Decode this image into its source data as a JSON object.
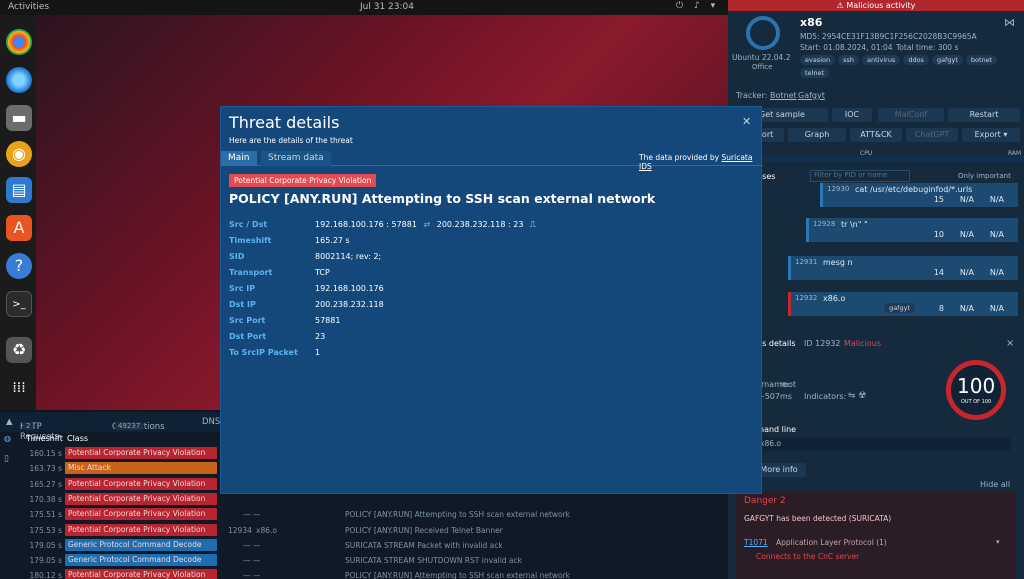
{
  "topbar": {
    "activities": "Activities",
    "clock": "Jul 31  23:04",
    "tray": "⏻ ♪ ▾"
  },
  "dock": {
    "icons": [
      "chrome-icon",
      "thunderbird-icon",
      "files-icon",
      "rhythmbox-icon",
      "writer-icon",
      "software-icon",
      "help-icon",
      "terminal-icon",
      "trash-icon",
      "apps-grid-icon"
    ]
  },
  "bottom": {
    "tabs": {
      "http": "HTTP Requests",
      "http_count": "2",
      "connections": "Connections",
      "connections_count": "49237",
      "dns": "DNS"
    },
    "headers": {
      "timeshift": "Timeshift",
      "class": "Class"
    },
    "rows": [
      {
        "ts": "160.15 s",
        "cls": "Potential Corporate Privacy Violation",
        "color": "red",
        "pid": "",
        "proc": "",
        "m": "",
        "msg": ""
      },
      {
        "ts": "163.73 s",
        "cls": "Misc Attack",
        "color": "org",
        "pid": "",
        "proc": "",
        "m": "",
        "msg": ""
      },
      {
        "ts": "165.27 s",
        "cls": "Potential Corporate Privacy Violation",
        "color": "red",
        "pid": "",
        "proc": "",
        "m": "",
        "msg": ""
      },
      {
        "ts": "170.38 s",
        "cls": "Potential Corporate Privacy Violation",
        "color": "red",
        "pid": "",
        "proc": "",
        "m": "",
        "msg": ""
      },
      {
        "ts": "175.51 s",
        "cls": "Potential Corporate Privacy Violation",
        "color": "red",
        "pid": "",
        "proc": "",
        "m": "— —",
        "msg": "POLICY [ANY.RUN] Attempting to SSH scan external network"
      },
      {
        "ts": "175.53 s",
        "cls": "Potential Corporate Privacy Violation",
        "color": "red",
        "pid": "12934",
        "proc": "x86.o",
        "m": "",
        "msg": "POLICY [ANY.RUN] Received Telnet Banner"
      },
      {
        "ts": "179.05 s",
        "cls": "Generic Protocol Command Decode",
        "color": "blu",
        "pid": "",
        "proc": "",
        "m": "— —",
        "msg": "SURICATA STREAM Packet with invalid ack"
      },
      {
        "ts": "179.05 s",
        "cls": "Generic Protocol Command Decode",
        "color": "blu",
        "pid": "",
        "proc": "",
        "m": "— —",
        "msg": "SURICATA STREAM SHUTDOWN RST invalid ack"
      },
      {
        "ts": "180.12 s",
        "cls": "Potential Corporate Privacy Violation",
        "color": "red",
        "pid": "",
        "proc": "",
        "m": "— —",
        "msg": "POLICY [ANY.RUN] Attempting to SSH scan external network"
      }
    ]
  },
  "right": {
    "banner": "Malicious activity",
    "os_name": "Ubuntu 22.04.2",
    "os_sub": "Office",
    "file": "x86",
    "md5": "MD5: 2954CE31F13B9C1F256C2028B3C9965A",
    "start": "Start: 01.08.2024, 01:04",
    "total": "Total time: 300 s",
    "tags": [
      "evasion",
      "ssh",
      "antivirus",
      "ddos",
      "gafgyt",
      "botnet",
      "telnet"
    ],
    "tracker_label": "Tracker:",
    "trackers": [
      "Botnet",
      "Gafgyt"
    ],
    "buttons": {
      "sample": "Get sample",
      "ioc": "IOC",
      "malconf": "MalConf",
      "restart": "Restart",
      "report": "Report",
      "graph": "Graph",
      "attack": "ATT&CK",
      "chatgpt": "ChatGPT",
      "export": "Export"
    },
    "cpu": "CPU",
    "ram": "RAM",
    "processes_label": "Processes",
    "filter_placeholder": "Filter by PID or name",
    "only_important": "Only important",
    "procs": [
      {
        "pid": "12930",
        "name": "cat  /usr/etc/debuginfod/*.urls",
        "val": "15",
        "na1": "N/A",
        "na2": "N/A"
      },
      {
        "pid": "12928",
        "name": "tr  \\n\" \"",
        "val": "10",
        "na1": "N/A",
        "na2": "N/A"
      },
      {
        "pid": "12931",
        "name": "mesg  n",
        "val": "14",
        "na1": "N/A",
        "na2": "N/A"
      },
      {
        "pid": "12932",
        "name": "x86.o",
        "val": "8",
        "na1": "N/A",
        "na2": "N/A",
        "tag": "gafgyt"
      }
    ],
    "details_label": "Process details",
    "details_id": "ID 12932",
    "details_verdict": "Malicious",
    "user_label": "Username:",
    "user": "root",
    "time": "+507ms",
    "indicators_label": "Indicators:",
    "score": "100",
    "score_sub": "OUT OF 100",
    "cmd_label": "Command line",
    "cmd": "/tmp/x86.o",
    "more_info": "More info",
    "hide_all": "Hide all",
    "danger_label": "Danger",
    "danger_count": "2",
    "danger1": "GAFGYT has been detected (SURICATA)",
    "t1071": "T1071",
    "t1071_desc": "Application Layer Protocol (1)",
    "cnc": "Connects to the CnC server"
  },
  "modal": {
    "title": "Threat details",
    "subtitle": "Here are the details of the threat",
    "tabs": [
      "Main",
      "Stream data"
    ],
    "provider_prefix": "The data provided by",
    "provider": "Suricata IDS",
    "category": "Potential Corporate Privacy Violation",
    "headline": "POLICY [ANY.RUN] Attempting to SSH scan external network",
    "src_dst_label": "Src / Dst",
    "src_dst_a": "192.168.100.176 : 57881",
    "src_dst_b": "200.238.232.118 : 23",
    "fields": [
      {
        "k": "Timeshift",
        "v": "165.27 s"
      },
      {
        "k": "SID",
        "v": "8002114; rev: 2;"
      },
      {
        "k": "Transport",
        "v": "TCP"
      },
      {
        "k": "Src IP",
        "v": "192.168.100.176"
      },
      {
        "k": "Dst IP",
        "v": "200.238.232.118"
      },
      {
        "k": "Src Port",
        "v": "57881"
      },
      {
        "k": "Dst Port",
        "v": "23"
      },
      {
        "k": "To SrcIP Packet",
        "v": "1"
      }
    ]
  }
}
